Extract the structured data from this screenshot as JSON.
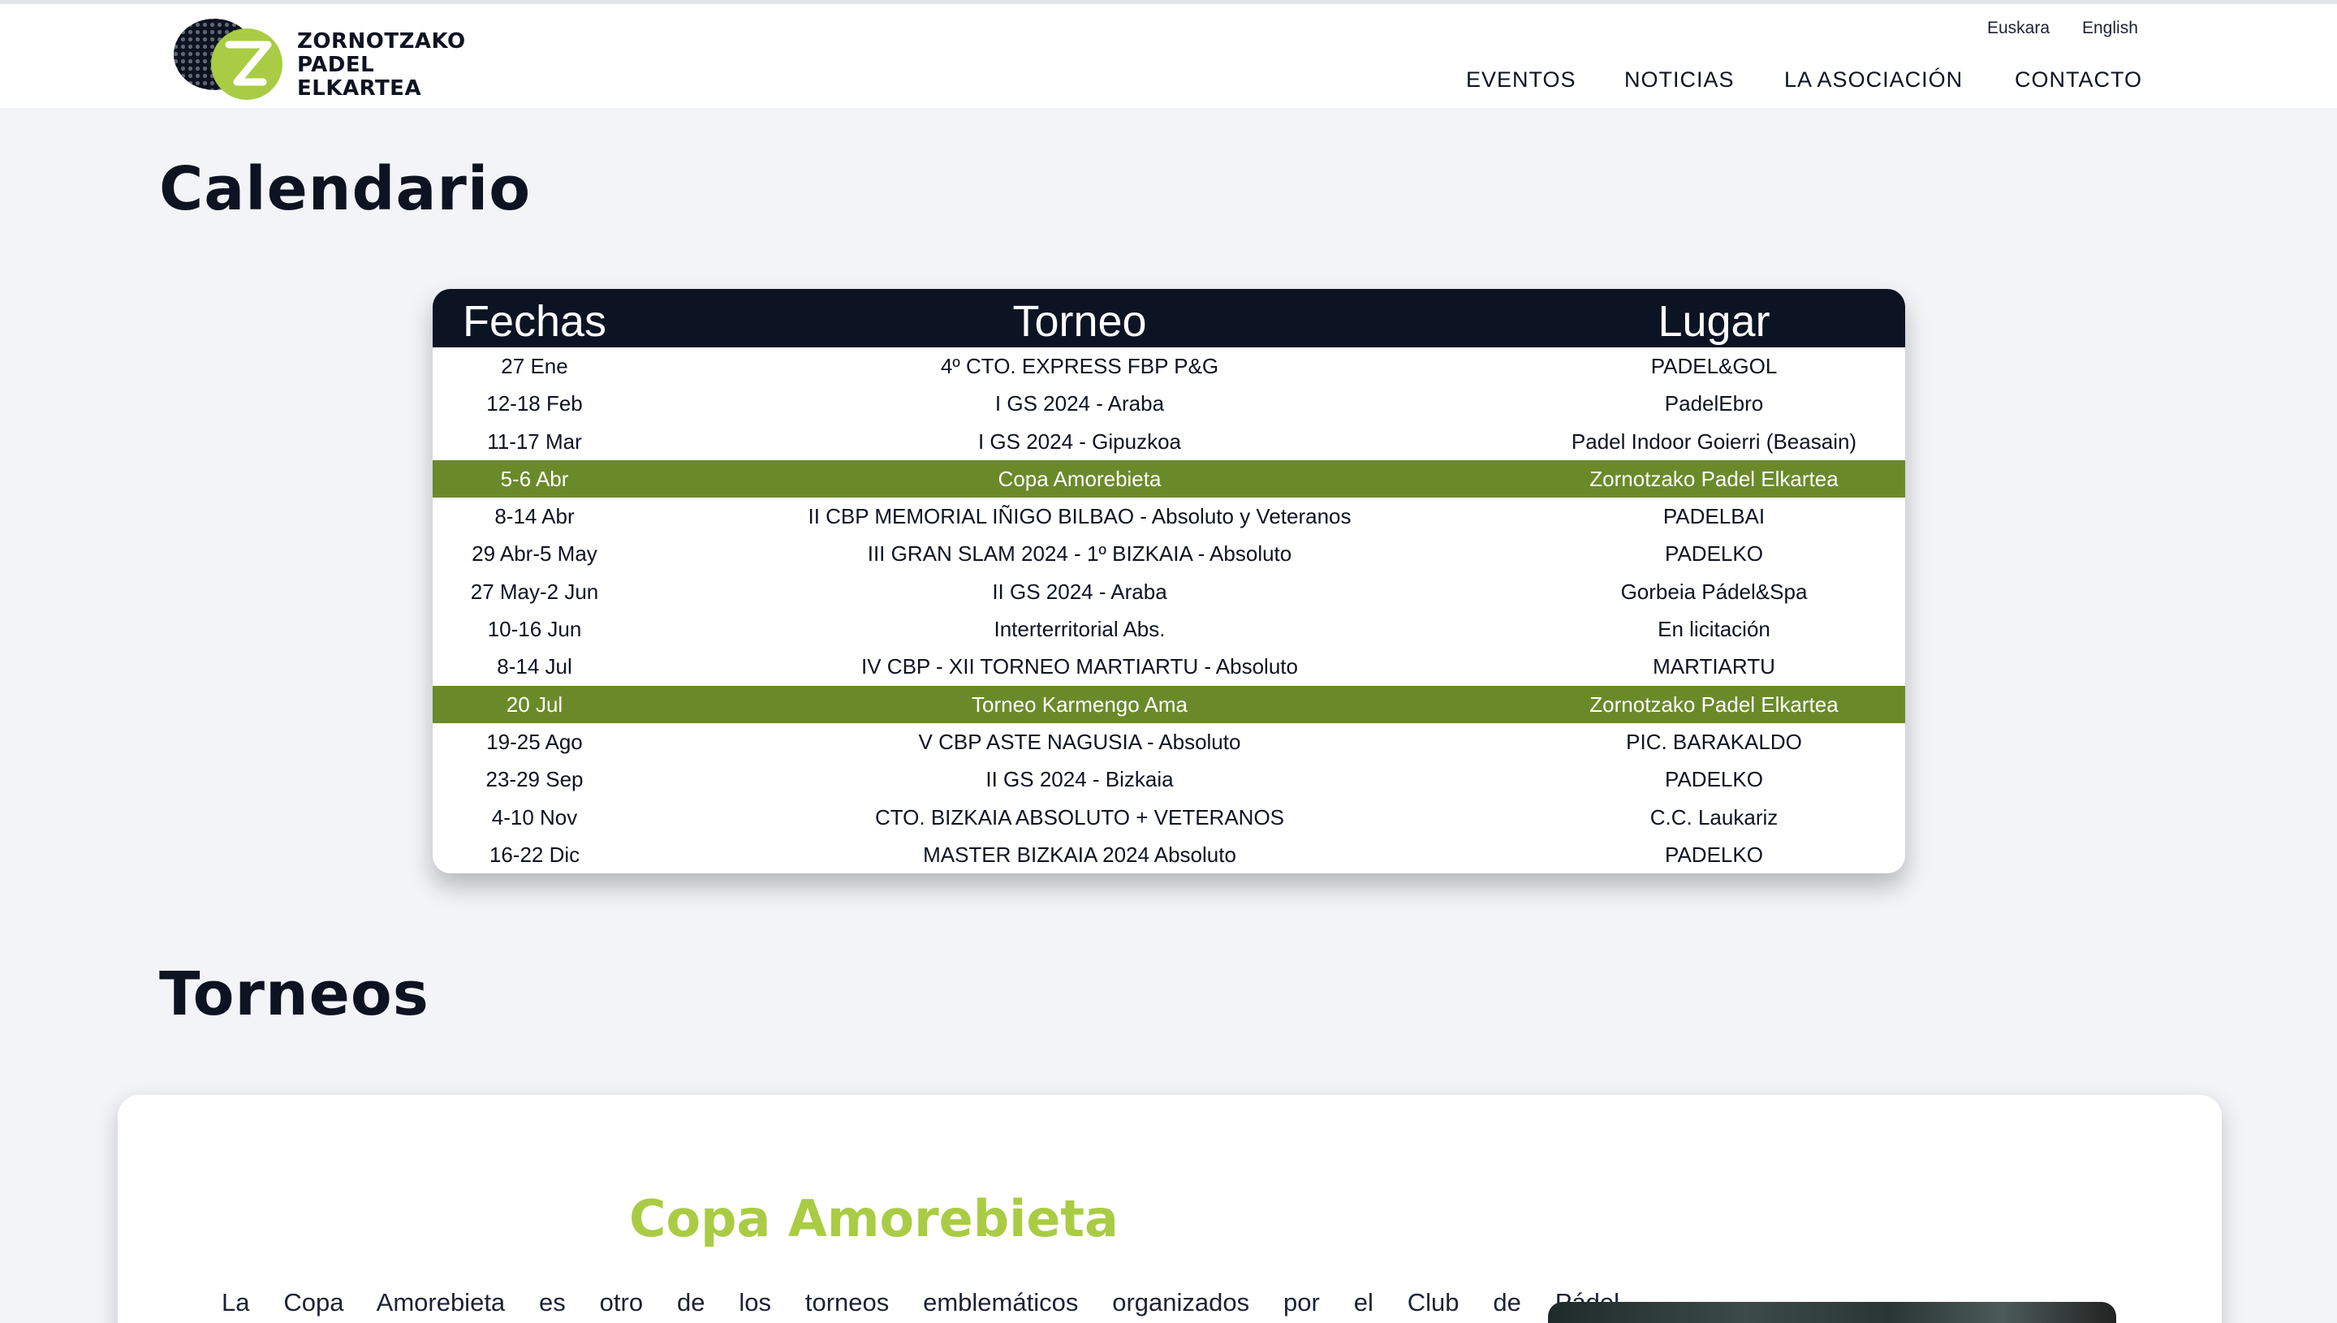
{
  "brand": {
    "name_lines": [
      "ZORNOTZAKO",
      "PADEL",
      "ELKARTEA"
    ],
    "colors": {
      "dark": "#0d1321",
      "accent_green": "#a9cc44",
      "highlight_row": "#6a8a2a"
    }
  },
  "header": {
    "languages": [
      "Euskara",
      "English"
    ],
    "nav": [
      "EVENTOS",
      "NOTICIAS",
      "LA ASOCIACIÓN",
      "CONTACTO"
    ]
  },
  "calendar": {
    "title": "Calendario",
    "columns": [
      "Fechas",
      "Torneo",
      "Lugar"
    ],
    "rows": [
      {
        "fecha": "27 Ene",
        "torneo": "4º CTO. EXPRESS FBP P&G",
        "lugar": "PADEL&GOL",
        "highlight": false
      },
      {
        "fecha": "12-18 Feb",
        "torneo": "I GS 2024 - Araba",
        "lugar": "PadelEbro",
        "highlight": false
      },
      {
        "fecha": "11-17 Mar",
        "torneo": "I GS 2024 - Gipuzkoa",
        "lugar": "Padel Indoor Goierri (Beasain)",
        "highlight": false
      },
      {
        "fecha": "5-6 Abr",
        "torneo": "Copa Amorebieta",
        "lugar": "Zornotzako Padel Elkartea",
        "highlight": true
      },
      {
        "fecha": "8-14 Abr",
        "torneo": "II CBP MEMORIAL IÑIGO BILBAO - Absoluto y Veteranos",
        "lugar": "PADELBAI",
        "highlight": false
      },
      {
        "fecha": "29 Abr-5 May",
        "torneo": "III GRAN SLAM 2024 - 1º BIZKAIA - Absoluto",
        "lugar": "PADELKO",
        "highlight": false
      },
      {
        "fecha": "27 May-2 Jun",
        "torneo": "II GS 2024 - Araba",
        "lugar": "Gorbeia Pádel&Spa",
        "highlight": false
      },
      {
        "fecha": "10-16 Jun",
        "torneo": "Interterritorial Abs.",
        "lugar": "En licitación",
        "highlight": false
      },
      {
        "fecha": "8-14 Jul",
        "torneo": "IV CBP - XII TORNEO MARTIARTU - Absoluto",
        "lugar": "MARTIARTU",
        "highlight": false
      },
      {
        "fecha": "20 Jul",
        "torneo": "Torneo Karmengo Ama",
        "lugar": "Zornotzako Padel Elkartea",
        "highlight": true
      },
      {
        "fecha": "19-25 Ago",
        "torneo": "V CBP ASTE NAGUSIA - Absoluto",
        "lugar": "PIC. BARAKALDO",
        "highlight": false
      },
      {
        "fecha": "23-29 Sep",
        "torneo": "II GS 2024 - Bizkaia",
        "lugar": "PADELKO",
        "highlight": false
      },
      {
        "fecha": "4-10 Nov",
        "torneo": "CTO. BIZKAIA ABSOLUTO + VETERANOS",
        "lugar": "C.C. Laukariz",
        "highlight": false
      },
      {
        "fecha": "16-22 Dic",
        "torneo": "MASTER BIZKAIA 2024 Absoluto",
        "lugar": "PADELKO",
        "highlight": false
      }
    ]
  },
  "torneos": {
    "title": "Torneos",
    "card": {
      "title": "Copa Amorebieta",
      "text": "La Copa Amorebieta es otro de los torneos emblemáticos organizados por el Club de Pádel"
    }
  }
}
